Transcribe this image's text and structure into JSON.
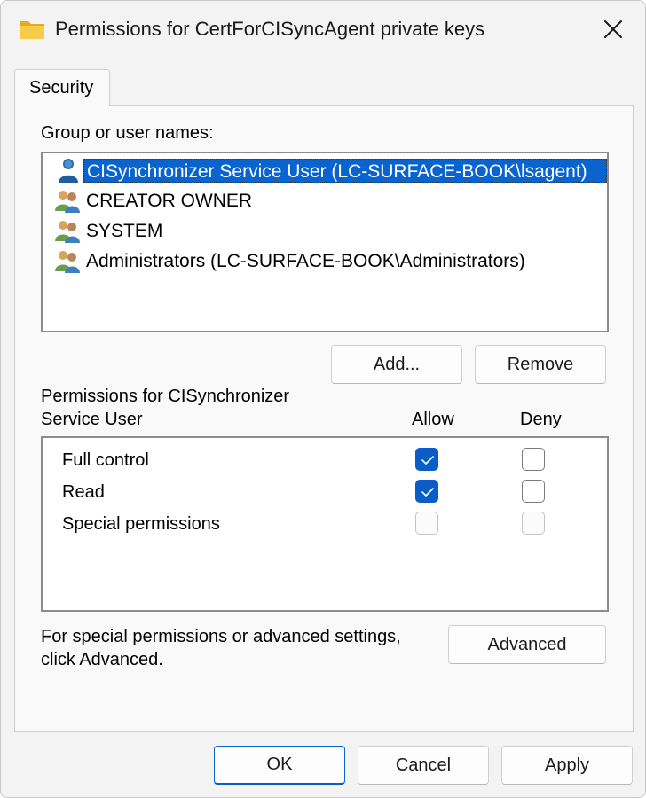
{
  "window": {
    "title": "Permissions for CertForCISyncAgent private keys"
  },
  "tabs": [
    {
      "label": "Security"
    }
  ],
  "group_label": "Group or user names:",
  "users": [
    {
      "label": "CISynchronizer Service User (LC-SURFACE-BOOK\\lsagent)",
      "icon": "user-icon",
      "selected": true
    },
    {
      "label": "CREATOR OWNER",
      "icon": "group-icon",
      "selected": false
    },
    {
      "label": "SYSTEM",
      "icon": "group-icon",
      "selected": false
    },
    {
      "label": "Administrators (LC-SURFACE-BOOK\\Administrators)",
      "icon": "group-icon",
      "selected": false
    }
  ],
  "buttons": {
    "add": "Add...",
    "remove": "Remove",
    "advanced": "Advanced",
    "ok": "OK",
    "cancel": "Cancel",
    "apply": "Apply"
  },
  "permissions_header": {
    "line1": "Permissions for CISynchronizer",
    "line2": "Service User",
    "allow": "Allow",
    "deny": "Deny"
  },
  "permissions": [
    {
      "name": "Full control",
      "allow": "checked",
      "deny": "unchecked"
    },
    {
      "name": "Read",
      "allow": "checked",
      "deny": "unchecked"
    },
    {
      "name": "Special permissions",
      "allow": "disabled",
      "deny": "disabled"
    }
  ],
  "advanced_text": {
    "line1": "For special permissions or advanced settings,",
    "line2": "click Advanced."
  },
  "colors": {
    "accent": "#0a64d0",
    "folder": "#f4c542"
  }
}
